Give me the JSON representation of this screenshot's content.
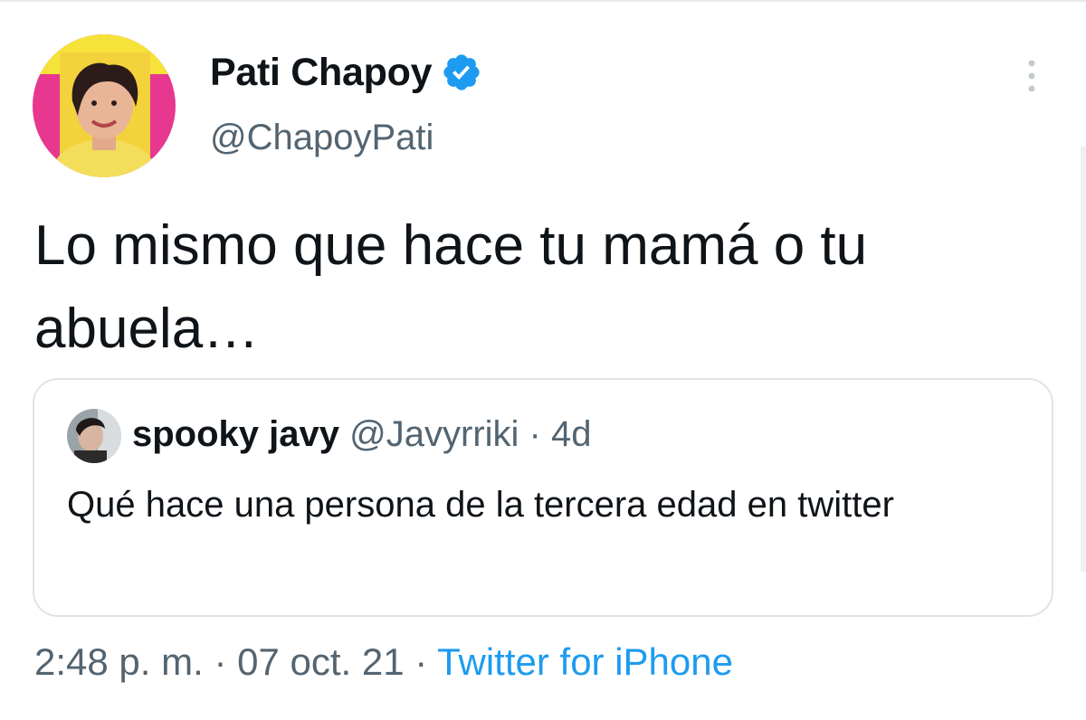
{
  "author": {
    "display_name": "Pati Chapoy",
    "handle": "@ChapoyPati",
    "verified": true
  },
  "tweet": {
    "text": "Lo mismo que hace tu mamá o tu abuela…"
  },
  "quoted_tweet": {
    "display_name": "spooky javy",
    "handle": "@Javyrriki",
    "separator": "·",
    "time": "4d",
    "text": "Qué hace una persona de la tercera edad en twitter"
  },
  "meta": {
    "time": "2:48 p. m.",
    "separator1": "·",
    "date": "07 oct. 21",
    "separator2": "·",
    "source": "Twitter for iPhone"
  },
  "icons": {
    "verified": "verified-badge-icon",
    "more": "more-options-icon"
  },
  "colors": {
    "verified_blue": "#1d9bf0",
    "link_blue": "#1d9bf0",
    "secondary_text": "#536471"
  }
}
